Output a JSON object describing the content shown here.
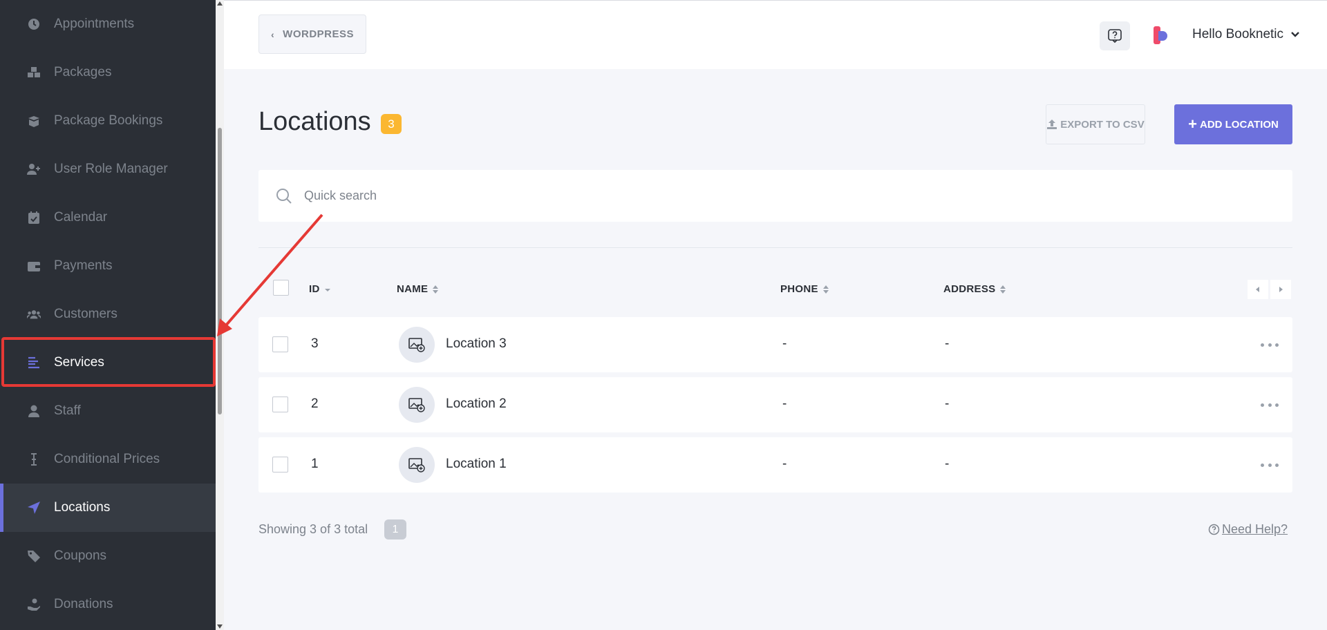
{
  "sidebar": {
    "items": [
      {
        "key": "appointments",
        "label": "Appointments",
        "icon": "clock-icon"
      },
      {
        "key": "packages",
        "label": "Packages",
        "icon": "boxes-icon"
      },
      {
        "key": "package-bookings",
        "label": "Package Bookings",
        "icon": "box-open-icon"
      },
      {
        "key": "user-role-manager",
        "label": "User Role Manager",
        "icon": "user-plus-icon"
      },
      {
        "key": "calendar",
        "label": "Calendar",
        "icon": "calendar-check-icon"
      },
      {
        "key": "payments",
        "label": "Payments",
        "icon": "wallet-icon"
      },
      {
        "key": "customers",
        "label": "Customers",
        "icon": "users-icon"
      },
      {
        "key": "services",
        "label": "Services",
        "icon": "list-lines-icon"
      },
      {
        "key": "staff",
        "label": "Staff",
        "icon": "user-icon"
      },
      {
        "key": "conditional-prices",
        "label": "Conditional Prices",
        "icon": "i-cursor-icon"
      },
      {
        "key": "locations",
        "label": "Locations",
        "icon": "location-arrow-icon"
      },
      {
        "key": "coupons",
        "label": "Coupons",
        "icon": "tag-icon"
      },
      {
        "key": "donations",
        "label": "Donations",
        "icon": "hand-holding-icon"
      }
    ],
    "active": "Locations",
    "highlighted": "Services"
  },
  "header": {
    "wordpress_label": "WORDPRESS",
    "user_greeting": "Hello Booknetic"
  },
  "main": {
    "title": "Locations",
    "count": "3",
    "export_label": "EXPORT TO CSV",
    "add_label": "ADD LOCATION",
    "search_placeholder": "Quick search"
  },
  "table": {
    "columns": [
      "ID",
      "NAME",
      "PHONE",
      "ADDRESS"
    ],
    "rows": [
      {
        "id": "3",
        "name": "Location 3",
        "phone": "-",
        "address": "-"
      },
      {
        "id": "2",
        "name": "Location 2",
        "phone": "-",
        "address": "-"
      },
      {
        "id": "1",
        "name": "Location 1",
        "phone": "-",
        "address": "-"
      }
    ]
  },
  "footer": {
    "showing": "Showing 3 of 3 total",
    "page": "1",
    "need_help": "Need Help?"
  },
  "colors": {
    "sidebar_bg": "#2b2f36",
    "accent": "#6c70dc",
    "badge": "#fbb731",
    "highlight_red": "#e53935"
  }
}
